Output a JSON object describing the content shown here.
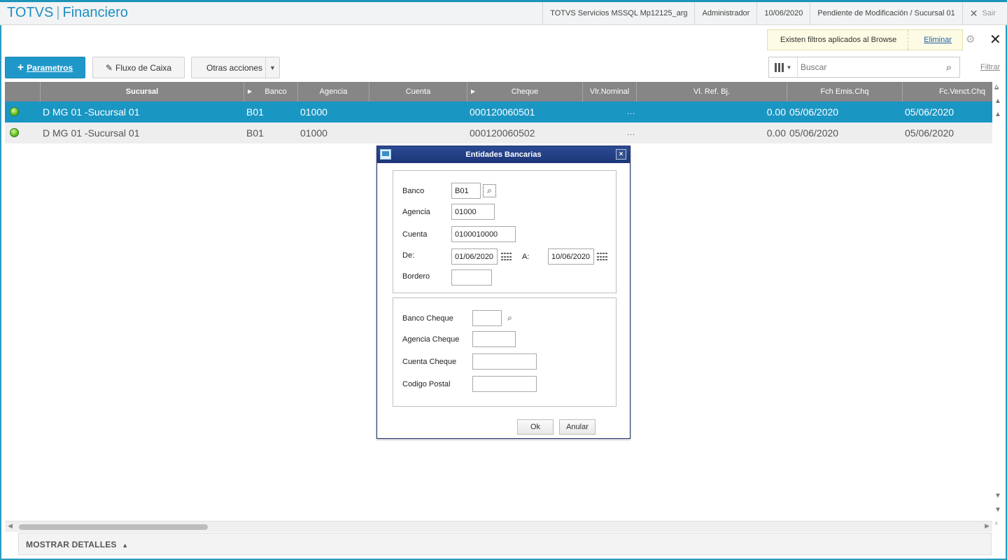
{
  "app": {
    "brand": "TOTVS",
    "module": "Financiero"
  },
  "header": {
    "server": "TOTVS Servicios MSSQL Mp12125_arg",
    "user": "Administrador",
    "date": "10/06/2020",
    "status": "Pendiente de Modificación / Sucursal 01",
    "exit_label": "Sair"
  },
  "filter_notice": {
    "message": "Existen filtros aplicados al Browse",
    "action": "Eliminar"
  },
  "toolbar": {
    "parametros": "Parametros",
    "fluxo": "Fluxo de Caixa",
    "otras": "Otras acciones",
    "search_placeholder": "Buscar",
    "filtrar": "Filtrar"
  },
  "grid": {
    "columns": [
      "Sucursal",
      "Banco",
      "Agencia",
      "Cuenta",
      "Cheque",
      "Vlr.Nominal",
      "Vl. Ref. Bj.",
      "Fch Emis.Chq",
      "Fc.Venct.Chq"
    ],
    "rows": [
      {
        "sucursal": "D MG 01 -Sucursal 01",
        "banco": "B01",
        "agencia": "01000",
        "cuenta": "",
        "cheque": "000120060501",
        "nominal": "...",
        "ref": "0.00",
        "emis": "05/06/2020",
        "venct": "05/06/2020"
      },
      {
        "sucursal": "D MG 01 -Sucursal 01",
        "banco": "B01",
        "agencia": "01000",
        "cuenta": "",
        "cheque": "000120060502",
        "nominal": "...",
        "ref": "0.00",
        "emis": "05/06/2020",
        "venct": "05/06/2020"
      }
    ]
  },
  "details_label": "MOSTRAR DETALLES",
  "dialog": {
    "title": "Entidades Bancarias",
    "labels": {
      "banco": "Banco",
      "agencia": "Agencia",
      "cuenta": "Cuenta",
      "de": "De:",
      "a": "A:",
      "bordero": "Bordero",
      "banco_cheque": "Banco Cheque",
      "agencia_cheque": "Agencia Cheque",
      "cuenta_cheque": "Cuenta Cheque",
      "codigo_postal": "Codigo Postal"
    },
    "values": {
      "banco": "B01",
      "agencia": "01000",
      "cuenta": "0100010000",
      "de": "01/06/2020",
      "a": "10/06/2020",
      "bordero": "",
      "banco_cheque": "",
      "agencia_cheque": "",
      "cuenta_cheque": "",
      "codigo_postal": ""
    },
    "ok": "Ok",
    "cancel": "Anular"
  },
  "colors": {
    "accent": "#1a96c3",
    "header_grid": "#868686",
    "dialog_title": "#1d3577"
  }
}
